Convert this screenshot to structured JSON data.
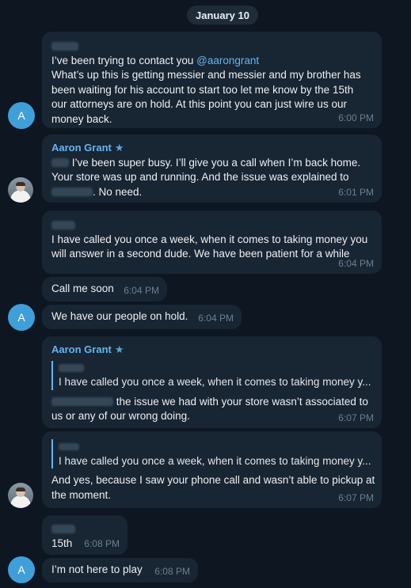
{
  "date_label": "January 10",
  "contact_avatar_letter": "A",
  "messages": [
    {
      "lines": [
        "I’ve been trying to contact you ",
        "What’s up this is getting messier and messier and my brother has",
        "been waiting for his account to start too let me know by the 15th",
        "our attorneys are on hold. At this point you can just wire us our",
        "money back."
      ],
      "mention": "@aarongrant",
      "time": "6:00 PM"
    },
    {
      "sender": "Aaron Grant",
      "lines": [
        " I’ve been super busy. I’ll give you a call when I’m back home.",
        "Your store was up and running. And the issue was explained to",
        ". No need."
      ],
      "time": "6:01 PM"
    },
    {
      "lines": [
        "I have called you once a week, when it comes to taking money you",
        "will answer in a second dude. We have been patient for a while"
      ],
      "time": "6:04 PM"
    },
    {
      "text": "Call me soon",
      "time": "6:04 PM"
    },
    {
      "text": "We have our people on hold.",
      "time": "6:04 PM"
    },
    {
      "sender": "Aaron Grant",
      "quote": "I have called you once a week, when it comes to taking money y...",
      "lines": [
        " the issue we had with your store wasn’t associated to",
        "us or any of our wrong doing."
      ],
      "time": "6:07 PM"
    },
    {
      "quote": "I have called you once a week, when it comes to taking money y...",
      "lines": [
        "And yes, because I saw your phone call and wasn’t able to pickup at",
        "the moment."
      ],
      "time": "6:07 PM"
    },
    {
      "text": "15th",
      "time": "6:08 PM"
    },
    {
      "text": "I’m not here to play",
      "time": "6:08 PM"
    }
  ]
}
